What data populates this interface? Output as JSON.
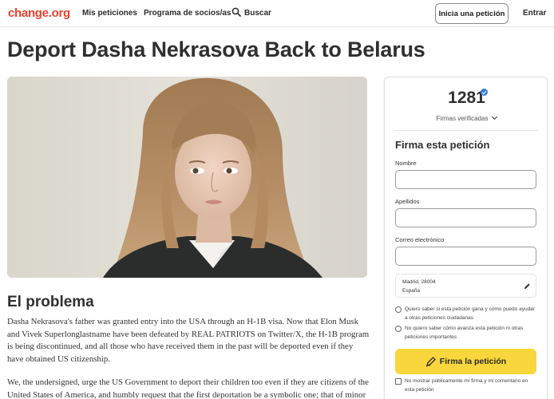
{
  "header": {
    "logo": "change.org",
    "nav": [
      "Mis peticiones",
      "Programa de socios/as",
      "Buscar"
    ],
    "start_button": "Inicia una petición",
    "login": "Entrar"
  },
  "petition": {
    "title": "Deport Dasha Nekrasova Back to Belarus",
    "section_title": "El problema",
    "paragraph1": "Dasha Nekrasova's father was granted entry into the USA through an H-1B visa.  Now that Elon Musk and Vivek Superlonglastname have been defeated by REAL PATRIOTS on Twitter/X, the H-1B program is being discontinued, and all those who have received them in the past will be deported even if they have obtained US citizenship.",
    "paragraph2": "We, the undersigned, urge the US Government to deport their children too even if they are citizens of the United States of America, and humbly request that the first deportation be a symbolic one; that of minor"
  },
  "sign_panel": {
    "count": "1281",
    "verified_label": "Firmas verificadas",
    "form_title": "Firma esta petición",
    "fields": {
      "first_name_label": "Nombre",
      "last_name_label": "Apellidos",
      "email_label": "Correo electrónico"
    },
    "location": {
      "line1": "Madrid, 28004",
      "line2": "España"
    },
    "radio_yes": "Quiero saber si esta petición gana y cómo puedo ayudar a otras peticiones ciudadanas",
    "radio_no": "No quiero saber cómo avanza esta petición ni otras peticiones importantes",
    "sign_button": "Firma la petición",
    "hide_checkbox": "No mostrar públicamente mi firma y mi comentario en esta petición"
  },
  "colors": {
    "brand": "#e8402f",
    "sign_button": "#f9d63c",
    "verified": "#3b7ddd"
  }
}
